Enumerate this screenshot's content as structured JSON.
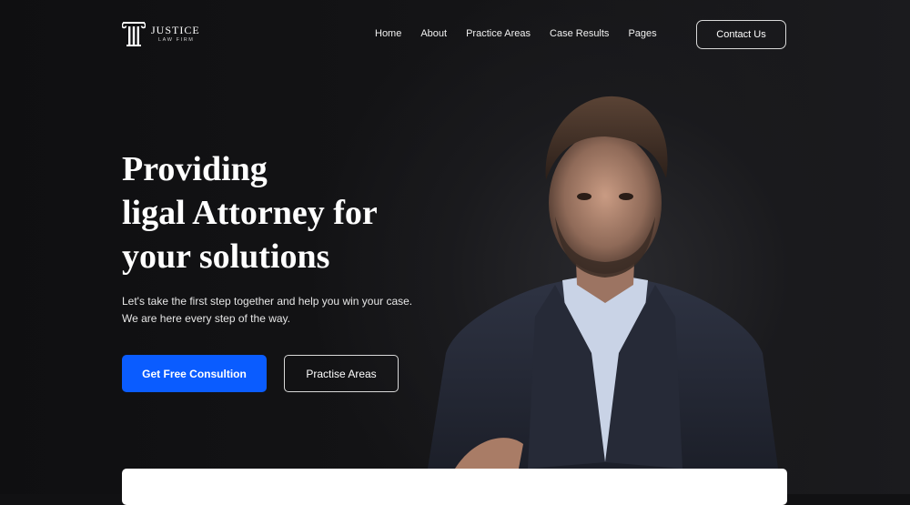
{
  "brand": {
    "name": "JUSTICE",
    "tagline": "LAW FIRM"
  },
  "nav": {
    "items": [
      {
        "label": "Home"
      },
      {
        "label": "About"
      },
      {
        "label": "Practice Areas"
      },
      {
        "label": "Case Results"
      },
      {
        "label": "Pages"
      }
    ],
    "contact_label": "Contact Us"
  },
  "hero": {
    "headline_lines": [
      "Providing",
      "ligal Attorney for",
      "your solutions"
    ],
    "description": "Let's take the first step together and help you win your case. We are here every step of the way.",
    "primary_button": "Get Free Consultion",
    "secondary_button": "Practise Areas"
  },
  "colors": {
    "accent": "#0a5cff",
    "background": "#111113"
  },
  "icons": {
    "logo": "pillar-icon"
  }
}
